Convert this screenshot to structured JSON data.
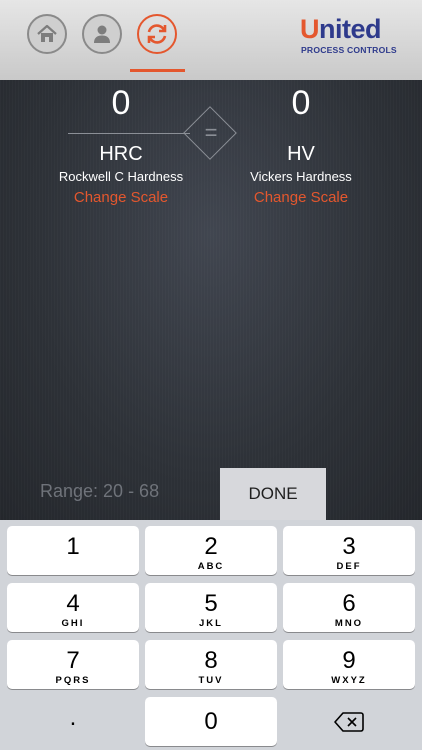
{
  "nav": {
    "items": [
      {
        "name": "home",
        "icon": "home-icon"
      },
      {
        "name": "profile",
        "icon": "user-icon"
      },
      {
        "name": "convert",
        "icon": "refresh-icon",
        "active": true
      }
    ]
  },
  "logo": {
    "brand_initial": "U",
    "brand_rest": "nited",
    "subtitle": "PROCESS CONTROLS"
  },
  "converter": {
    "left": {
      "value": "0",
      "code": "HRC",
      "name": "Rockwell C Hardness",
      "change_label": "Change Scale"
    },
    "right": {
      "value": "0",
      "code": "HV",
      "name": "Vickers Hardness",
      "change_label": "Change Scale"
    },
    "equals": "=",
    "range": "Range: 20 - 68",
    "done_label": "DONE"
  },
  "keypad": {
    "keys": [
      {
        "digit": "1",
        "letters": ""
      },
      {
        "digit": "2",
        "letters": "ABC"
      },
      {
        "digit": "3",
        "letters": "DEF"
      },
      {
        "digit": "4",
        "letters": "GHI"
      },
      {
        "digit": "5",
        "letters": "JKL"
      },
      {
        "digit": "6",
        "letters": "MNO"
      },
      {
        "digit": "7",
        "letters": "PQRS"
      },
      {
        "digit": "8",
        "letters": "TUV"
      },
      {
        "digit": "9",
        "letters": "WXYZ"
      },
      {
        "digit": ".",
        "letters": ""
      },
      {
        "digit": "0",
        "letters": ""
      },
      {
        "digit": "",
        "letters": "",
        "icon": "backspace-icon"
      }
    ]
  },
  "colors": {
    "accent": "#e4572e",
    "brand": "#2e3a8c",
    "background": "#2c3036"
  }
}
